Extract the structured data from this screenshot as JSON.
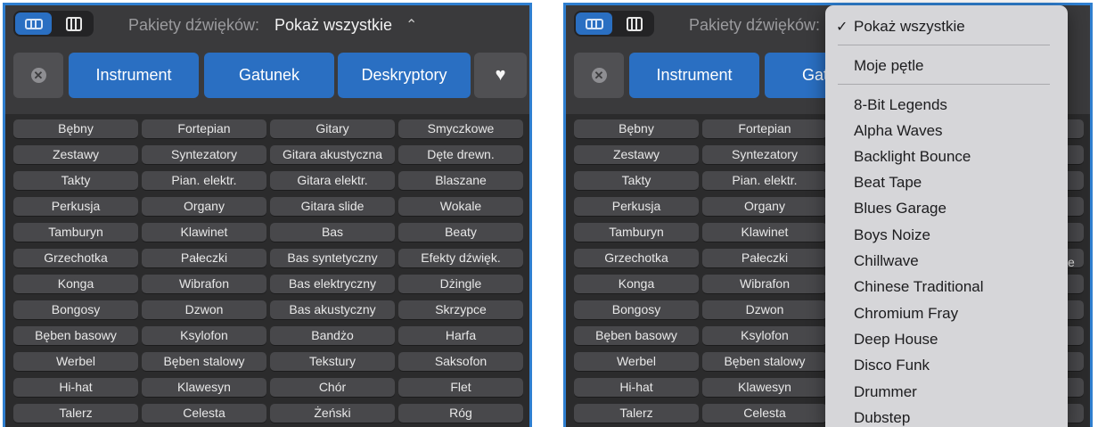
{
  "header": {
    "pack_label": "Pakiety dźwięków:",
    "pack_value": "Pokaż wszystkie",
    "stepper_glyph": "⌃⌄"
  },
  "filters": {
    "reset_glyph": "✕",
    "instrument": "Instrument",
    "genre": "Gatunek",
    "genre_truncated": "Gat",
    "descriptors": "Deskryptory",
    "favorites_glyph": "♥"
  },
  "keywords": [
    [
      "Bębny",
      "Fortepian",
      "Gitary",
      "Smyczkowe"
    ],
    [
      "Zestawy",
      "Syntezatory",
      "Gitara akustyczna",
      "Dęte drewn."
    ],
    [
      "Takty",
      "Pian. elektr.",
      "Gitara elektr.",
      "Blaszane"
    ],
    [
      "Perkusja",
      "Organy",
      "Gitara slide",
      "Wokale"
    ],
    [
      "Tamburyn",
      "Klawinet",
      "Bas",
      "Beaty"
    ],
    [
      "Grzechotka",
      "Pałeczki",
      "Bas syntetyczny",
      "Efekty dźwięk."
    ],
    [
      "Konga",
      "Wibrafon",
      "Bas elektryczny",
      "Dżingle"
    ],
    [
      "Bongosy",
      "Dzwon",
      "Bas akustyczny",
      "Skrzypce"
    ],
    [
      "Bęben basowy",
      "Ksylofon",
      "Bandżo",
      "Harfa"
    ],
    [
      "Werbel",
      "Bęben stalowy",
      "Tekstury",
      "Saksofon"
    ],
    [
      "Hi-hat",
      "Klawesyn",
      "Chór",
      "Flet"
    ],
    [
      "Talerz",
      "Celesta",
      "Żeński",
      "Róg"
    ]
  ],
  "right_edge_fragment": "e",
  "menu": {
    "checkmark": "✓",
    "items": [
      "Pokaż wszystkie",
      "Moje pętle",
      "8-Bit Legends",
      "Alpha Waves",
      "Backlight Bounce",
      "Beat Tape",
      "Blues Garage",
      "Boys Noize",
      "Chillwave",
      "Chinese Traditional",
      "Chromium Fray",
      "Deep House",
      "Disco Funk",
      "Drummer",
      "Dubstep"
    ]
  },
  "colors": {
    "accent_blue": "#2a6fc2",
    "panel_bg": "#2b2b2c",
    "menu_bg": "#d6d6d9"
  }
}
